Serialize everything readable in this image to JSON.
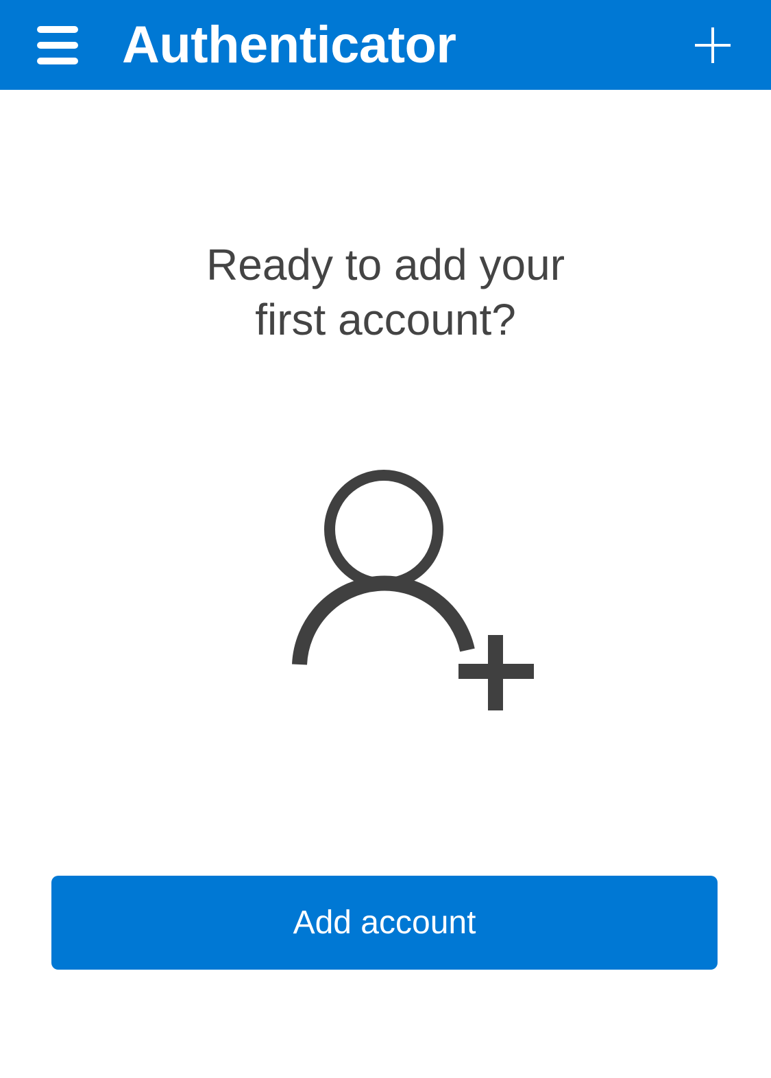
{
  "app_bar": {
    "title": "Authenticator",
    "menu_icon": "hamburger-menu-icon",
    "add_icon": "plus-icon",
    "background_color": "#0078d4"
  },
  "empty_state": {
    "prompt_line1": "Ready to add your",
    "prompt_line2": "first account?",
    "illustration_icon": "add-person-icon"
  },
  "actions": {
    "add_account_label": "Add account",
    "button_color": "#0078d4"
  }
}
